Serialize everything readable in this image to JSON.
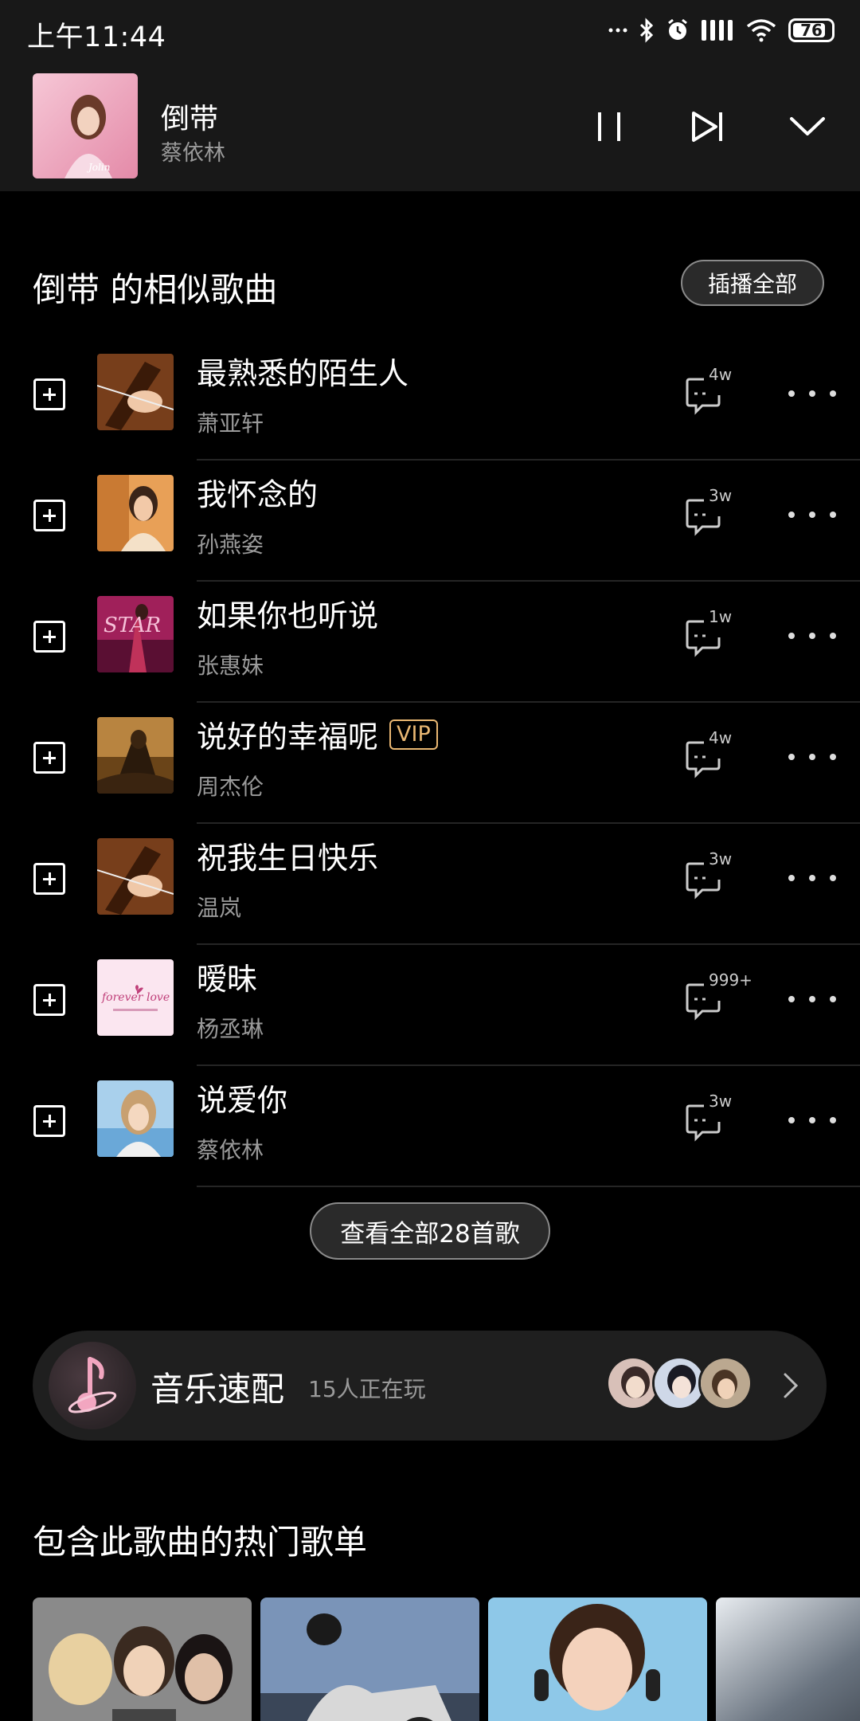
{
  "status_bar": {
    "time": "上午11:44",
    "battery": "76",
    "icons": [
      "more-dots-icon",
      "bluetooth-icon",
      "alarm-icon",
      "signal-icon",
      "wifi-icon",
      "battery-icon"
    ]
  },
  "mini_player": {
    "title": "倒带",
    "artist": "蔡依林",
    "buttons": [
      "pause-icon",
      "next-icon",
      "collapse-chevron-icon"
    ]
  },
  "similar": {
    "title": "倒带 的相似歌曲",
    "play_all": "插播全部",
    "songs": [
      {
        "title": "最熟悉的陌生人",
        "artist": "萧亚轩",
        "comments": "4w",
        "vip": false
      },
      {
        "title": "我怀念的",
        "artist": "孙燕姿",
        "comments": "3w",
        "vip": false
      },
      {
        "title": "如果你也听说",
        "artist": "张惠妹",
        "comments": "1w",
        "vip": false
      },
      {
        "title": "说好的幸福呢",
        "artist": "周杰伦",
        "comments": "4w",
        "vip": true,
        "vip_label": "VIP"
      },
      {
        "title": "祝我生日快乐",
        "artist": "温岚",
        "comments": "3w",
        "vip": false
      },
      {
        "title": "暧昧",
        "artist": "杨丞琳",
        "comments": "999+",
        "vip": false
      },
      {
        "title": "说爱你",
        "artist": "蔡依林",
        "comments": "3w",
        "vip": false
      }
    ],
    "view_all": "查看全部28首歌"
  },
  "music_match": {
    "title": "音乐速配",
    "subtitle": "15人正在玩"
  },
  "playlists": {
    "title": "包含此歌曲的热门歌单"
  },
  "colors": {
    "background": "#000000",
    "header_bg": "#181818",
    "vip": "#e9b772",
    "secondary_text": "#9a9a9a"
  }
}
